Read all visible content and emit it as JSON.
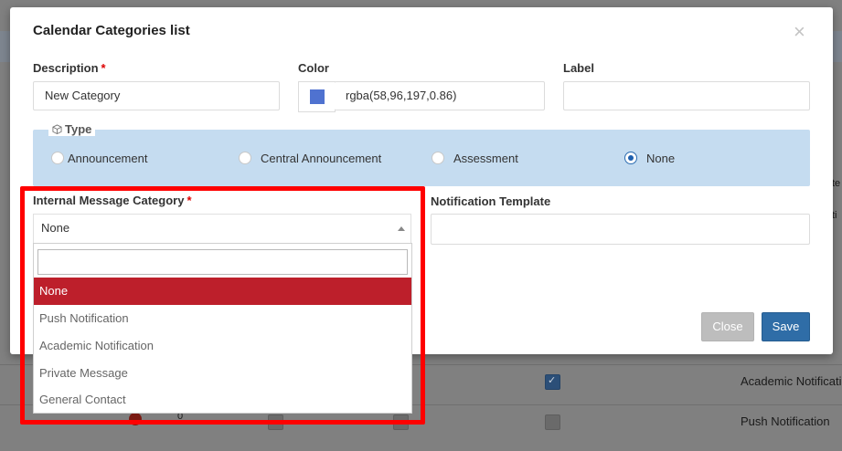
{
  "modal": {
    "title": "Calendar Categories list",
    "close_icon": "×"
  },
  "form": {
    "description_label": "Description",
    "required_mark": "*",
    "description_value": "New Category",
    "color_label": "Color",
    "color_value": "rgba(58,96,197,0.86)",
    "color_swatch": "#4f72d0",
    "label_label": "Label",
    "label_value": "",
    "type_legend": "Type",
    "type_options": [
      {
        "label": "Announcement",
        "checked": false
      },
      {
        "label": "Central Announcement",
        "checked": false
      },
      {
        "label": "Assessment",
        "checked": false
      },
      {
        "label": "None",
        "checked": true
      }
    ],
    "internal_message_category_label": "Internal Message Category",
    "internal_message_category_value": "None",
    "notification_template_label": "Notification Template",
    "notification_template_value": ""
  },
  "dropdown": {
    "search_value": "",
    "options": [
      "None",
      "Push Notification",
      "Academic Notification",
      "Private Message",
      "General Contact"
    ],
    "selected": "None"
  },
  "buttons": {
    "close": "Close",
    "save": "Save"
  },
  "background": {
    "row1_text": "Academic Notificati",
    "row2_text": "Push Notification",
    "peek_text_1": "te",
    "peek_text_2": "ti",
    "row2_number": "0"
  },
  "colors": {
    "highlight": "#ff0000",
    "selected_item": "#bd1f2b",
    "save_button": "#2f6da7",
    "type_box": "#c5dcf0"
  }
}
